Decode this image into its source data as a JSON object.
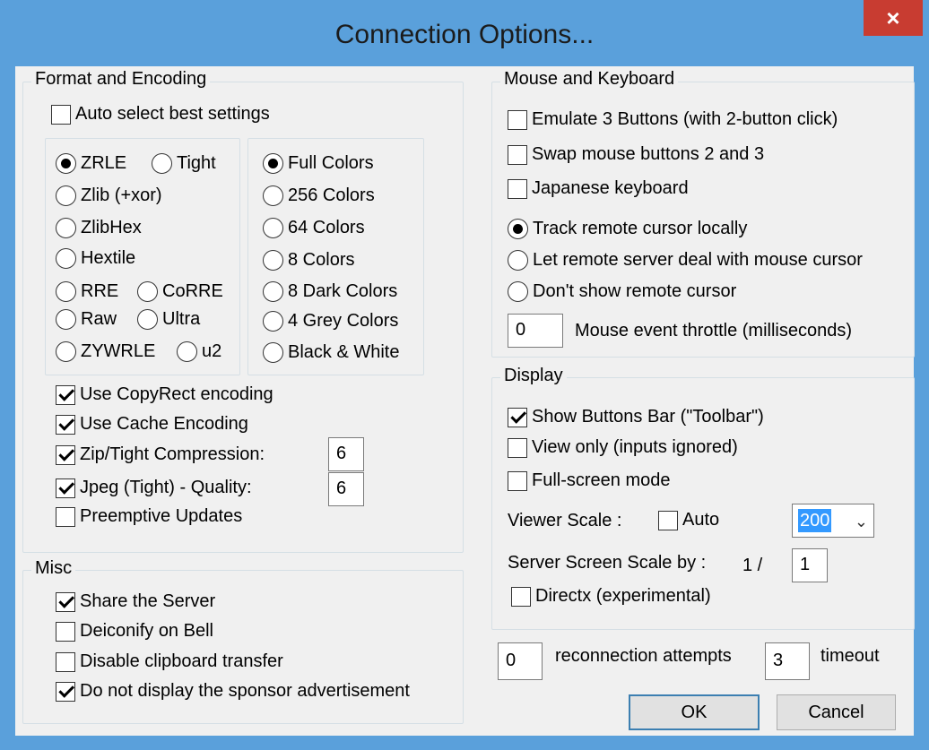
{
  "window": {
    "title": "Connection Options...",
    "close_icon": "×"
  },
  "format": {
    "title": "Format and Encoding",
    "auto_select": {
      "label": "Auto select best settings",
      "checked": false
    },
    "encodings": [
      {
        "label": "ZRLE",
        "checked": true
      },
      {
        "label": "Tight",
        "checked": false
      },
      {
        "label": "Zlib (+xor)",
        "checked": false
      },
      {
        "label": "ZlibHex",
        "checked": false
      },
      {
        "label": "Hextile",
        "checked": false
      },
      {
        "label": "RRE",
        "checked": false
      },
      {
        "label": "CoRRE",
        "checked": false
      },
      {
        "label": "Raw",
        "checked": false
      },
      {
        "label": "Ultra",
        "checked": false
      },
      {
        "label": "ZYWRLE",
        "checked": false
      },
      {
        "label": "u2",
        "checked": false
      }
    ],
    "colors": [
      {
        "label": "Full Colors",
        "checked": true
      },
      {
        "label": "256 Colors",
        "checked": false
      },
      {
        "label": "64 Colors",
        "checked": false
      },
      {
        "label": "8 Colors",
        "checked": false
      },
      {
        "label": "8 Dark Colors",
        "checked": false
      },
      {
        "label": "4 Grey Colors",
        "checked": false
      },
      {
        "label": "Black & White",
        "checked": false
      }
    ],
    "options": [
      {
        "label": "Use CopyRect encoding",
        "checked": true
      },
      {
        "label": "Use Cache Encoding",
        "checked": true
      },
      {
        "label": "Zip/Tight Compression:",
        "checked": true
      },
      {
        "label": "Jpeg (Tight) - Quality:",
        "checked": true
      },
      {
        "label": "Preemptive Updates",
        "checked": false
      }
    ],
    "zip_value": "6",
    "jpeg_value": "6"
  },
  "misc": {
    "title": "Misc",
    "options": [
      {
        "label": "Share the Server",
        "checked": true
      },
      {
        "label": "Deiconify on Bell",
        "checked": false
      },
      {
        "label": "Disable clipboard transfer",
        "checked": false
      },
      {
        "label": "Do not display the sponsor advertisement",
        "checked": true
      }
    ]
  },
  "mouse": {
    "title": "Mouse and Keyboard",
    "checks": [
      {
        "label": "Emulate 3 Buttons (with 2-button click)",
        "checked": false
      },
      {
        "label": "Swap mouse buttons 2 and 3",
        "checked": false
      },
      {
        "label": "Japanese keyboard",
        "checked": false
      }
    ],
    "cursor": [
      {
        "label": "Track remote cursor locally",
        "checked": true
      },
      {
        "label": "Let remote server deal with mouse cursor",
        "checked": false
      },
      {
        "label": "Don't show remote cursor",
        "checked": false
      }
    ],
    "throttle_value": "0",
    "throttle_label": "Mouse event throttle (milliseconds)"
  },
  "display": {
    "title": "Display",
    "checks": [
      {
        "label": "Show Buttons Bar (\"Toolbar\")",
        "checked": true
      },
      {
        "label": "View only (inputs ignored)",
        "checked": false
      },
      {
        "label": "Full-screen mode",
        "checked": false
      }
    ],
    "viewer_scale_label": "Viewer Scale :",
    "auto": {
      "label": "Auto",
      "checked": false
    },
    "scale_value": "200",
    "server_scale_label": "Server Screen Scale by :",
    "server_scale_prefix": "1  /",
    "server_scale_value": "1",
    "directx": {
      "label": "Directx (experimental)",
      "checked": false
    }
  },
  "reconnect": {
    "attempts_value": "0",
    "attempts_label": "reconnection attempts",
    "timeout_value": "3",
    "timeout_label": "timeout"
  },
  "buttons": {
    "ok": "OK",
    "cancel": "Cancel"
  }
}
